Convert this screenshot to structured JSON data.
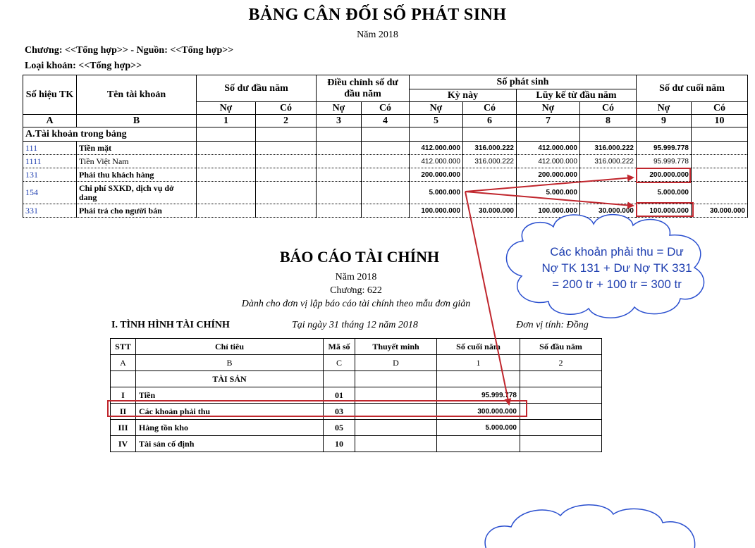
{
  "balance": {
    "title": "BẢNG CÂN ĐỐI SỐ PHÁT SINH",
    "year": "Năm 2018",
    "info1": "Chương: <<Tổng hợp>> - Nguồn: <<Tổng hợp>>",
    "info2": "Loại khoản: <<Tổng hợp>>",
    "headers": {
      "code": "Số hiệu TK",
      "name": "Tên tài khoản",
      "opening": "Số dư đầu năm",
      "adjust": "Điều chỉnh số dư đầu năm",
      "arising": "Số phát sinh",
      "period": "Kỳ này",
      "ytd": "Lũy kế từ đầu năm",
      "closing": "Số dư cuối năm",
      "no": "Nợ",
      "co": "Có"
    },
    "index_row": [
      "A",
      "B",
      "1",
      "2",
      "3",
      "4",
      "5",
      "6",
      "7",
      "8",
      "9",
      "10"
    ],
    "section": "A.Tài khoản trong bảng",
    "rows": [
      {
        "code": "111",
        "name": "Tiền mặt",
        "c5": "412.000.000",
        "c6": "316.000.222",
        "c7": "412.000.000",
        "c8": "316.000.222",
        "c9": "95.999.778",
        "c10": ""
      },
      {
        "code": "1111",
        "name": "Tiền Việt Nam",
        "c5": "412.000.000",
        "c6": "316.000.222",
        "c7": "412.000.000",
        "c8": "316.000.222",
        "c9": "95.999.778",
        "c10": ""
      },
      {
        "code": "131",
        "name": "Phải thu khách hàng",
        "c5": "200.000.000",
        "c6": "",
        "c7": "200.000.000",
        "c8": "",
        "c9": "200.000.000",
        "c10": ""
      },
      {
        "code": "154",
        "name": "Chi phí SXKD, dịch vụ dở",
        "name2": "dang",
        "c5": "5.000.000",
        "c6": "",
        "c7": "5.000.000",
        "c8": "",
        "c9": "5.000.000",
        "c10": ""
      },
      {
        "code": "331",
        "name": "Phải trả cho người bán",
        "c5": "100.000.000",
        "c6": "30.000.000",
        "c7": "100.000.000",
        "c8": "30.000.000",
        "c9": "100.000.000",
        "c10": "30.000.000"
      }
    ]
  },
  "report": {
    "title": "BÁO CÁO TÀI CHÍNH",
    "year": "Năm 2018",
    "chapter": "Chương: 622",
    "subtitle": "Dành cho đơn vị lập báo cáo tài chính theo mẫu đơn giản",
    "section": "I. TÌNH HÌNH TÀI CHÍNH",
    "date": "Tại ngày 31 tháng 12 năm 2018",
    "unit": "Đơn vị tính: Đồng",
    "headers": [
      "STT",
      "Chỉ tiêu",
      "Mã số",
      "Thuyết minh",
      "Số cuối năm",
      "Số đầu năm"
    ],
    "index_row": [
      "A",
      "B",
      "C",
      "D",
      "1",
      "2"
    ],
    "group": "TÀI SẢN",
    "rows": [
      {
        "stt": "I",
        "name": "Tiền",
        "code": "01",
        "end": "95.999.778"
      },
      {
        "stt": "II",
        "name": "Các khoản phải thu",
        "code": "03",
        "end": "300.000.000"
      },
      {
        "stt": "III",
        "name": "Hàng tồn kho",
        "code": "05",
        "end": "5.000.000"
      },
      {
        "stt": "IV",
        "name": "Tài sản cố định",
        "code": "10",
        "end": ""
      }
    ]
  },
  "callout": {
    "line1": "Các khoản phải thu = Dư",
    "line2": "Nợ TK 131 + Dư Nợ TK 331",
    "line3": "= 200 tr + 100 tr = 300 tr"
  },
  "colors": {
    "highlight": "#c0262d",
    "cloud_border": "#2a4fcf",
    "text_blue": "#1f3fb0"
  }
}
